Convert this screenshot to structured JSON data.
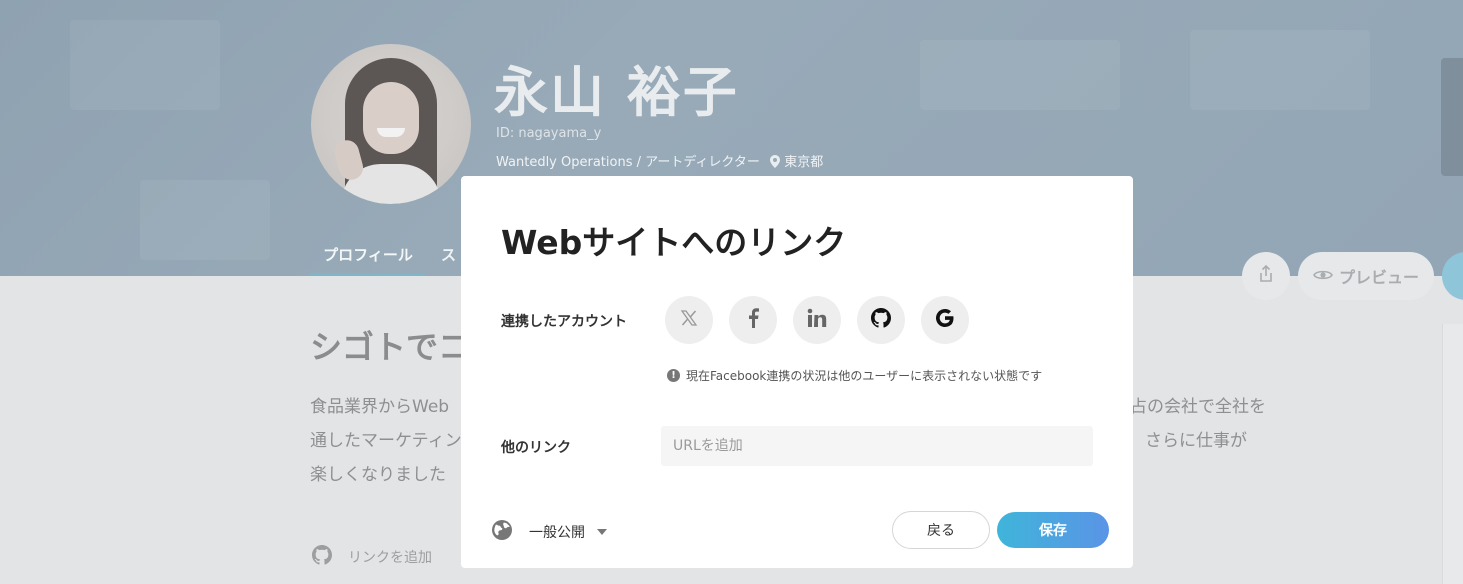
{
  "profile": {
    "name": "永山 裕子",
    "user_id": "ID: nagayama_y",
    "company_role": "Wantedly Operations / アートディレクター",
    "location": "東京都",
    "tabs": [
      "プロフィール",
      "ス"
    ],
    "preview_label": "プレビュー",
    "headline": "シゴトでコ",
    "bio_lines_left": [
      "食品業界からWeb",
      "通したマーケティン",
      "楽しくなりました"
    ],
    "bio_lines_right": [
      "占の会社で全社を",
      "さらに仕事が"
    ],
    "add_link_label": "リンクを追加"
  },
  "modal": {
    "title": "Webサイトへのリンク",
    "linked_accounts_label": "連携したアカウント",
    "accounts": [
      {
        "service": "X",
        "icon": "x-icon"
      },
      {
        "service": "Facebook",
        "icon": "facebook-icon"
      },
      {
        "service": "LinkedIn",
        "icon": "linkedin-icon"
      },
      {
        "service": "GitHub",
        "icon": "github-icon"
      },
      {
        "service": "Google",
        "icon": "google-icon"
      }
    ],
    "notice": "現在Facebook連携の状況は他のユーザーに表示されない状態です",
    "other_links_label": "他のリンク",
    "url_placeholder": "URLを追加",
    "url_value": "",
    "visibility_label": "一般公開",
    "back_label": "戻る",
    "save_label": "保存"
  },
  "colors": {
    "cover": "#93a6b5",
    "save_gradient_start": "#3fb5da",
    "save_gradient_end": "#5a94e6",
    "tab_underline": "#7fb6c7"
  }
}
